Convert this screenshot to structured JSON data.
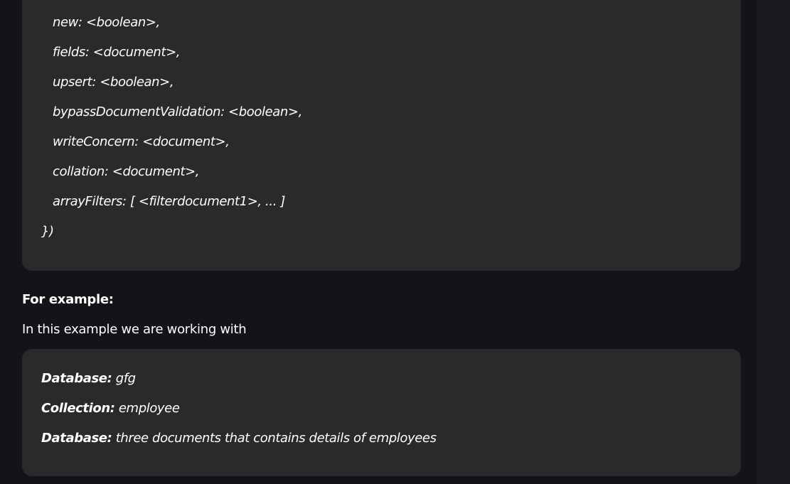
{
  "code_block": {
    "lines": [
      "new: <boolean>,",
      "fields: <document>,",
      "upsert: <boolean>,",
      "bypassDocumentValidation: <boolean>,",
      "writeConcern: <document>,",
      "collation: <document>,",
      "arrayFilters: [ <filterdocument1>, ... ]",
      "})"
    ]
  },
  "example": {
    "heading": "For example:",
    "intro": "In this example we are working with"
  },
  "info_block": {
    "rows": [
      {
        "key": "Database:",
        "value": " gfg"
      },
      {
        "key": "Collection:",
        "value": " employee"
      },
      {
        "key": "Database:",
        "value": " three documents that contains details of employees"
      }
    ]
  }
}
